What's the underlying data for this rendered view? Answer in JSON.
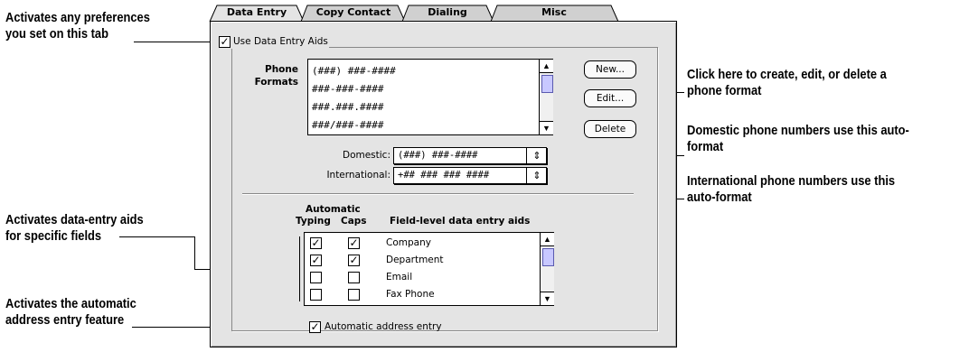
{
  "tabs": [
    {
      "label": "Data Entry"
    },
    {
      "label": "Copy Contact"
    },
    {
      "label": "Dialing"
    },
    {
      "label": "Misc"
    }
  ],
  "use_data_entry_aids": {
    "label": "Use Data Entry Aids",
    "checked": true
  },
  "phone_formats": {
    "label_line1": "Phone",
    "label_line2": "Formats",
    "items": [
      "(###) ###-####",
      "###-###-####",
      "###.###.####",
      "###/###-####"
    ]
  },
  "buttons": {
    "new": "New...",
    "edit": "Edit...",
    "delete": "Delete"
  },
  "domestic": {
    "label": "Domestic:",
    "value": "(###) ###-####"
  },
  "international": {
    "label": "International:",
    "value": "+## ### ### ####"
  },
  "field_aids": {
    "header_automatic": "Automatic",
    "header_typing": "Typing",
    "header_caps": "Caps",
    "header_fields": "Field-level data entry aids",
    "rows": [
      {
        "field": "Company",
        "typing": true,
        "caps": true
      },
      {
        "field": "Department",
        "typing": true,
        "caps": true
      },
      {
        "field": "Email",
        "typing": false,
        "caps": false
      },
      {
        "field": "Fax Phone",
        "typing": false,
        "caps": false
      }
    ]
  },
  "automatic_address": {
    "label": "Automatic address entry",
    "checked": true
  },
  "callouts": {
    "left1_line1": "Activates any preferences",
    "left1_line2": "you set on this tab",
    "left2_line1": "Activates data-entry aids",
    "left2_line2": "for specific fields",
    "left3_line1": "Activates the automatic",
    "left3_line2": "address entry feature",
    "right1_line1": "Click here to create, edit, or delete a",
    "right1_line2": "phone format",
    "right2_line1": "Domestic phone numbers use this auto-",
    "right2_line2": "format",
    "right3_line1": "International phone numbers use this",
    "right3_line2": "auto-format"
  },
  "check_glyph": "✓",
  "colors": {
    "panel": "#e4e4e4",
    "scroll_thumb": "#c8c8ff"
  }
}
